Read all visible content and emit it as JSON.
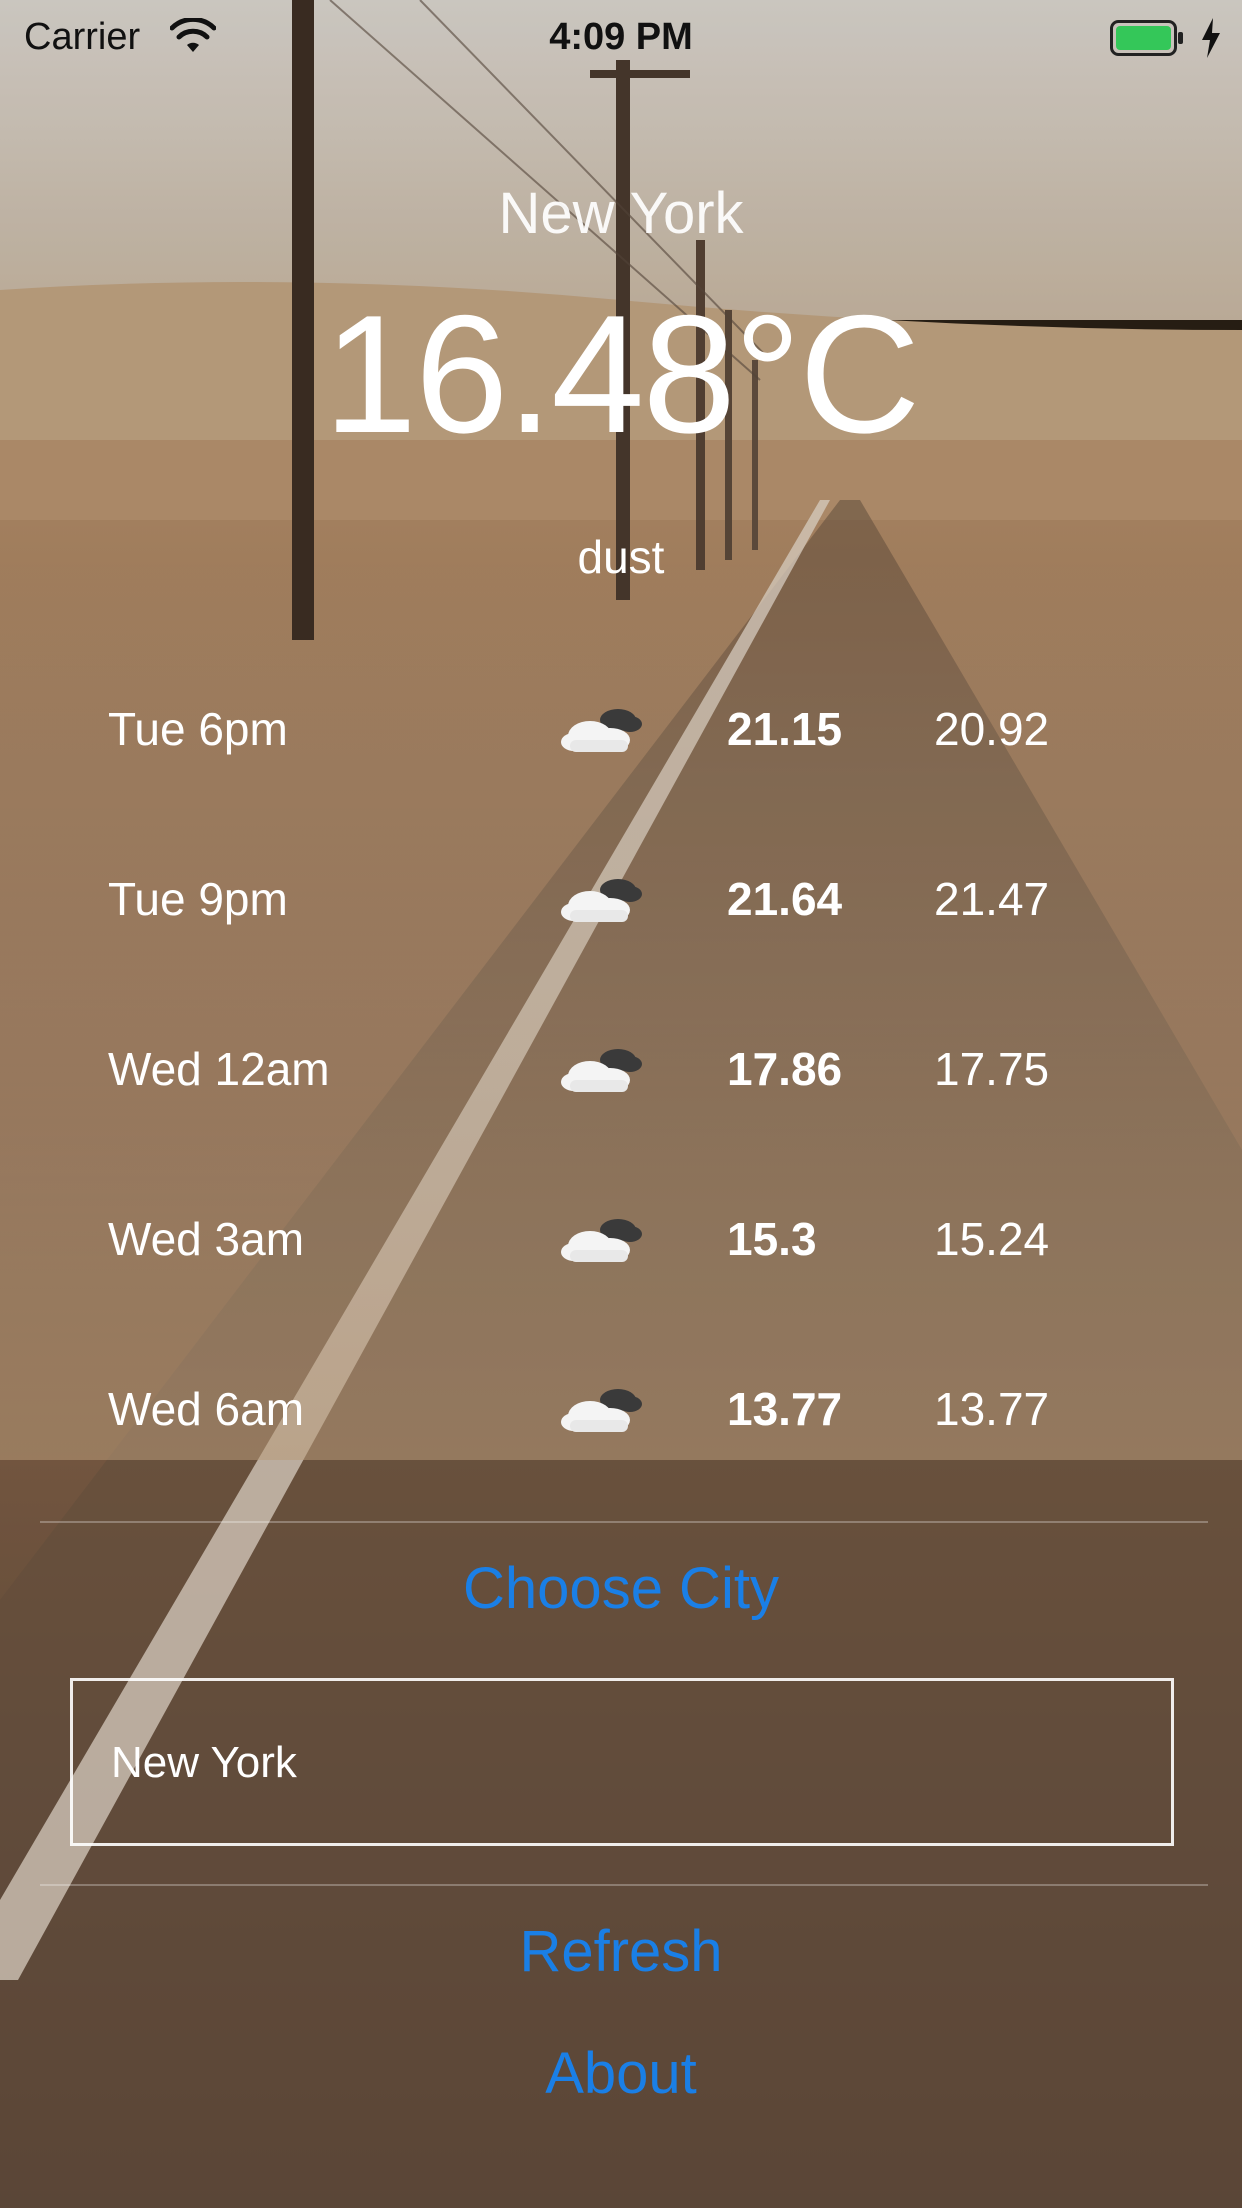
{
  "status_bar": {
    "carrier": "Carrier",
    "time": "4:09 PM",
    "wifi_icon": "wifi-icon",
    "battery_icon": "battery-icon",
    "charging_icon": "charging-bolt-icon",
    "battery_color": "#34c759"
  },
  "header": {
    "city": "New York",
    "temperature": "16.48°C",
    "description": "dust"
  },
  "forecast": [
    {
      "time": "Tue 6pm",
      "icon": "partly-cloudy-icon",
      "high": "21.15",
      "low": "20.92"
    },
    {
      "time": "Tue 9pm",
      "icon": "partly-cloudy-icon",
      "high": "21.64",
      "low": "21.47"
    },
    {
      "time": "Wed 12am",
      "icon": "partly-cloudy-icon",
      "high": "17.86",
      "low": "17.75"
    },
    {
      "time": "Wed 3am",
      "icon": "partly-cloudy-icon",
      "high": "15.3",
      "low": "15.24"
    },
    {
      "time": "Wed 6am",
      "icon": "partly-cloudy-icon",
      "high": "13.77",
      "low": "13.77"
    }
  ],
  "controls": {
    "choose_city_label": "Choose City",
    "city_input_value": "New York",
    "refresh_label": "Refresh",
    "about_label": "About",
    "accent_color": "#1a7fe6"
  }
}
